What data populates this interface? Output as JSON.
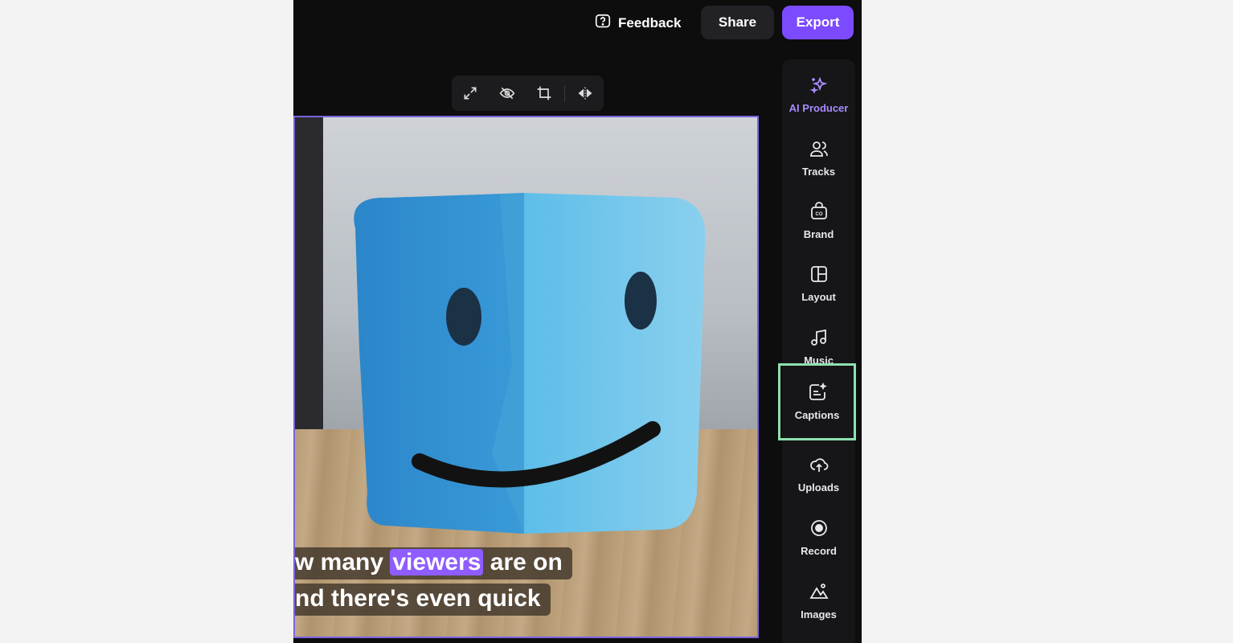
{
  "header": {
    "feedback_label": "Feedback",
    "share_label": "Share",
    "export_label": "Export"
  },
  "canvas_toolbar": {
    "tools": [
      "expand-icon",
      "hide-icon",
      "crop-icon",
      "flip-icon"
    ]
  },
  "preview": {
    "caption_line1_before": "w many ",
    "caption_line1_highlight": "viewers",
    "caption_line1_after": " are on",
    "caption_line2": "nd there's even quick"
  },
  "sidebar": {
    "items": [
      {
        "label": "AI Producer",
        "icon": "sparkle-icon"
      },
      {
        "label": "Tracks",
        "icon": "people-icon"
      },
      {
        "label": "Brand",
        "icon": "brand-kit-icon"
      },
      {
        "label": "Layout",
        "icon": "layout-icon"
      },
      {
        "label": "Music",
        "icon": "music-note-icon"
      },
      {
        "label": "Captions",
        "icon": "captions-icon"
      },
      {
        "label": "Uploads",
        "icon": "cloud-upload-icon"
      },
      {
        "label": "Record",
        "icon": "record-icon"
      },
      {
        "label": "Images",
        "icon": "images-icon"
      }
    ]
  },
  "colors": {
    "accent": "#7c4bff",
    "highlight_box": "#8fe0b0"
  }
}
